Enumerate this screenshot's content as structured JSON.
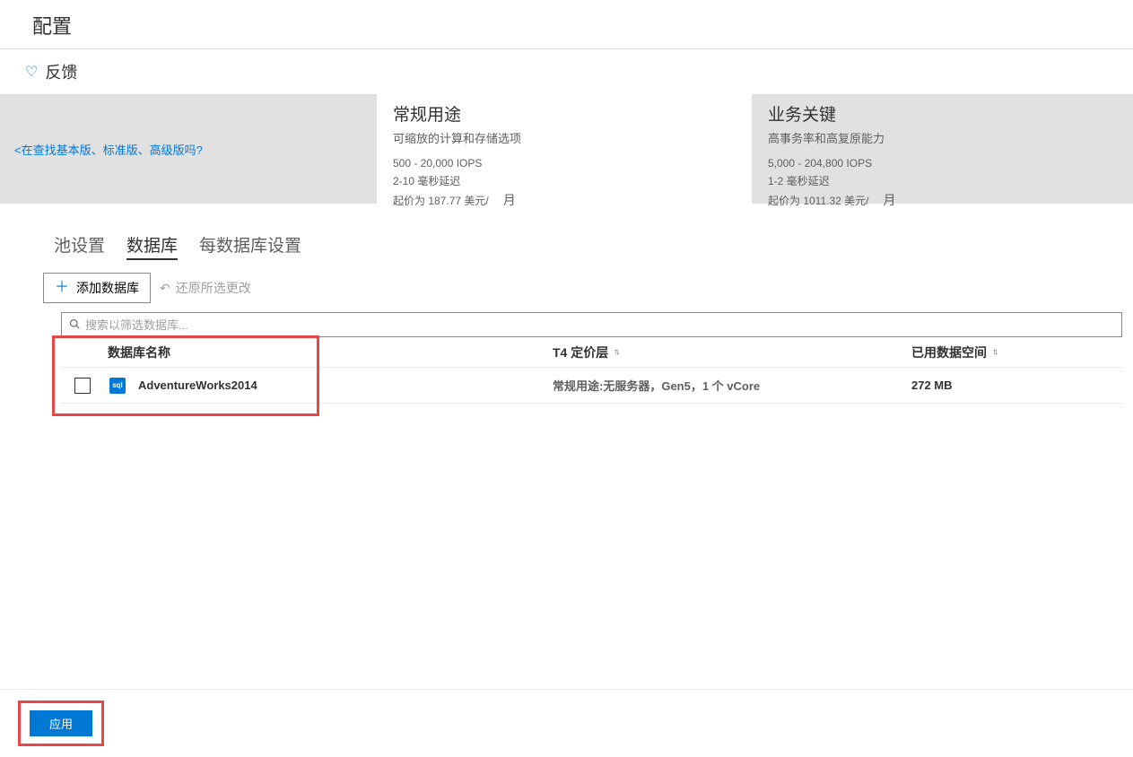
{
  "header": {
    "title": "配置",
    "feedback_label": "反馈"
  },
  "tier_selector": {
    "legacy_link": "<在查找基本版、标准版、高级版吗?",
    "tiers": [
      {
        "title": "常规用途",
        "subtitle": "可缩放的计算和存储选项",
        "iops": "500 - 20,000 IOPS",
        "latency": "2-10 毫秒延迟",
        "price_prefix": "起价为 187.77 美元/",
        "price_period": "月"
      },
      {
        "title": "业务关键",
        "subtitle": "高事务率和高复原能力",
        "iops": "5,000 - 204,800 IOPS",
        "latency": "1-2 毫秒延迟",
        "price_prefix": "起价为 1011.32 美元/",
        "price_period": "月"
      }
    ]
  },
  "tabs": {
    "pool": "池设置",
    "databases": "数据库",
    "per_db": "每数据库设置"
  },
  "toolbar": {
    "add_database": "添加数据库",
    "undo_label": "还原所选更改"
  },
  "search": {
    "placeholder": "搜索以筛选数据库..."
  },
  "table": {
    "columns": {
      "name": "数据库名称",
      "tier": "T4 定价层",
      "space": "已用数据空间"
    },
    "rows": [
      {
        "name": "AdventureWorks2014",
        "tier": "常规用途:无服务器，Gen5，1 个 vCore",
        "space": "272 MB"
      }
    ]
  },
  "footer": {
    "apply": "应用"
  }
}
